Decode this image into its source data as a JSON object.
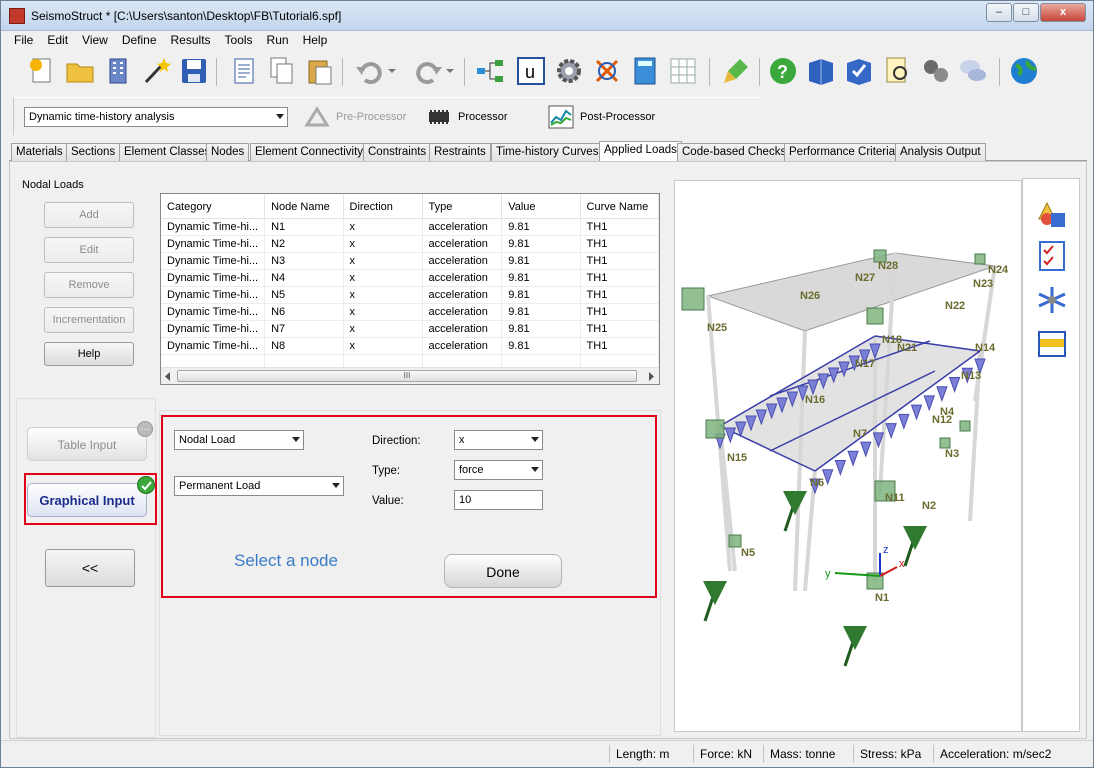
{
  "window": {
    "title": "SeismoStruct * [C:\\Users\\santon\\Desktop\\FB\\Tutorial6.spf]",
    "controls": {
      "minimize": "–",
      "maximize": "□",
      "close": "x"
    }
  },
  "menu": [
    "File",
    "Edit",
    "View",
    "Define",
    "Results",
    "Tools",
    "Run",
    "Help"
  ],
  "toolbar2": {
    "analysis_type": "Dynamic time-history analysis",
    "modes": {
      "pre": "Pre-Processor",
      "proc": "Processor",
      "post": "Post-Processor"
    }
  },
  "tabs": [
    "Materials",
    "Sections",
    "Element Classes",
    "Nodes",
    "Element Connectivity",
    "Constraints",
    "Restraints",
    "Time-history Curves",
    "Applied Loads",
    "Code-based Checks",
    "Performance Criteria",
    "Analysis Output"
  ],
  "nodal_loads": {
    "group_title": "Nodal Loads",
    "buttons": {
      "add": "Add",
      "edit": "Edit",
      "remove": "Remove",
      "incrementation": "Incrementation",
      "help": "Help"
    },
    "columns": [
      "Category",
      "Node Name",
      "Direction",
      "Type",
      "Value",
      "Curve Name"
    ],
    "rows": [
      [
        "Dynamic Time-hi...",
        "N1",
        "x",
        "acceleration",
        "9.81",
        "TH1"
      ],
      [
        "Dynamic Time-hi...",
        "N2",
        "x",
        "acceleration",
        "9.81",
        "TH1"
      ],
      [
        "Dynamic Time-hi...",
        "N3",
        "x",
        "acceleration",
        "9.81",
        "TH1"
      ],
      [
        "Dynamic Time-hi...",
        "N4",
        "x",
        "acceleration",
        "9.81",
        "TH1"
      ],
      [
        "Dynamic Time-hi...",
        "N5",
        "x",
        "acceleration",
        "9.81",
        "TH1"
      ],
      [
        "Dynamic Time-hi...",
        "N6",
        "x",
        "acceleration",
        "9.81",
        "TH1"
      ],
      [
        "Dynamic Time-hi...",
        "N7",
        "x",
        "acceleration",
        "9.81",
        "TH1"
      ],
      [
        "Dynamic Time-hi...",
        "N8",
        "x",
        "acceleration",
        "9.81",
        "TH1"
      ]
    ],
    "scroll_grip": "III"
  },
  "input_mode": {
    "table": "Table Input",
    "graphical": "Graphical Input",
    "back": "<<"
  },
  "graphical_form": {
    "load_kind": "Nodal Load",
    "load_category": "Permanent Load",
    "direction_label": "Direction:",
    "direction_value": "x",
    "type_label": "Type:",
    "type_value": "force",
    "value_label": "Value:",
    "value": "10",
    "hint": "Select a node",
    "done": "Done"
  },
  "model_nodes": [
    "N28",
    "N27",
    "N24",
    "N23",
    "N26",
    "N22",
    "N25",
    "N18",
    "N21",
    "N14",
    "N17",
    "N13",
    "N16",
    "N4",
    "N12",
    "N7",
    "N3",
    "N15",
    "N6",
    "N11",
    "N2",
    "N5",
    "N1"
  ],
  "axes": {
    "z": "z",
    "x": "x",
    "y": "y"
  },
  "status": {
    "length": "Length: m",
    "force": "Force: kN",
    "mass": "Mass: tonne",
    "stress": "Stress: kPa",
    "accel": "Acceleration: m/sec2"
  },
  "colors": {
    "selection_red": "#e3001b",
    "load_cone": "#7b7fd6",
    "support_green": "#2f7a2f",
    "node_label": "#6b6b2f"
  }
}
